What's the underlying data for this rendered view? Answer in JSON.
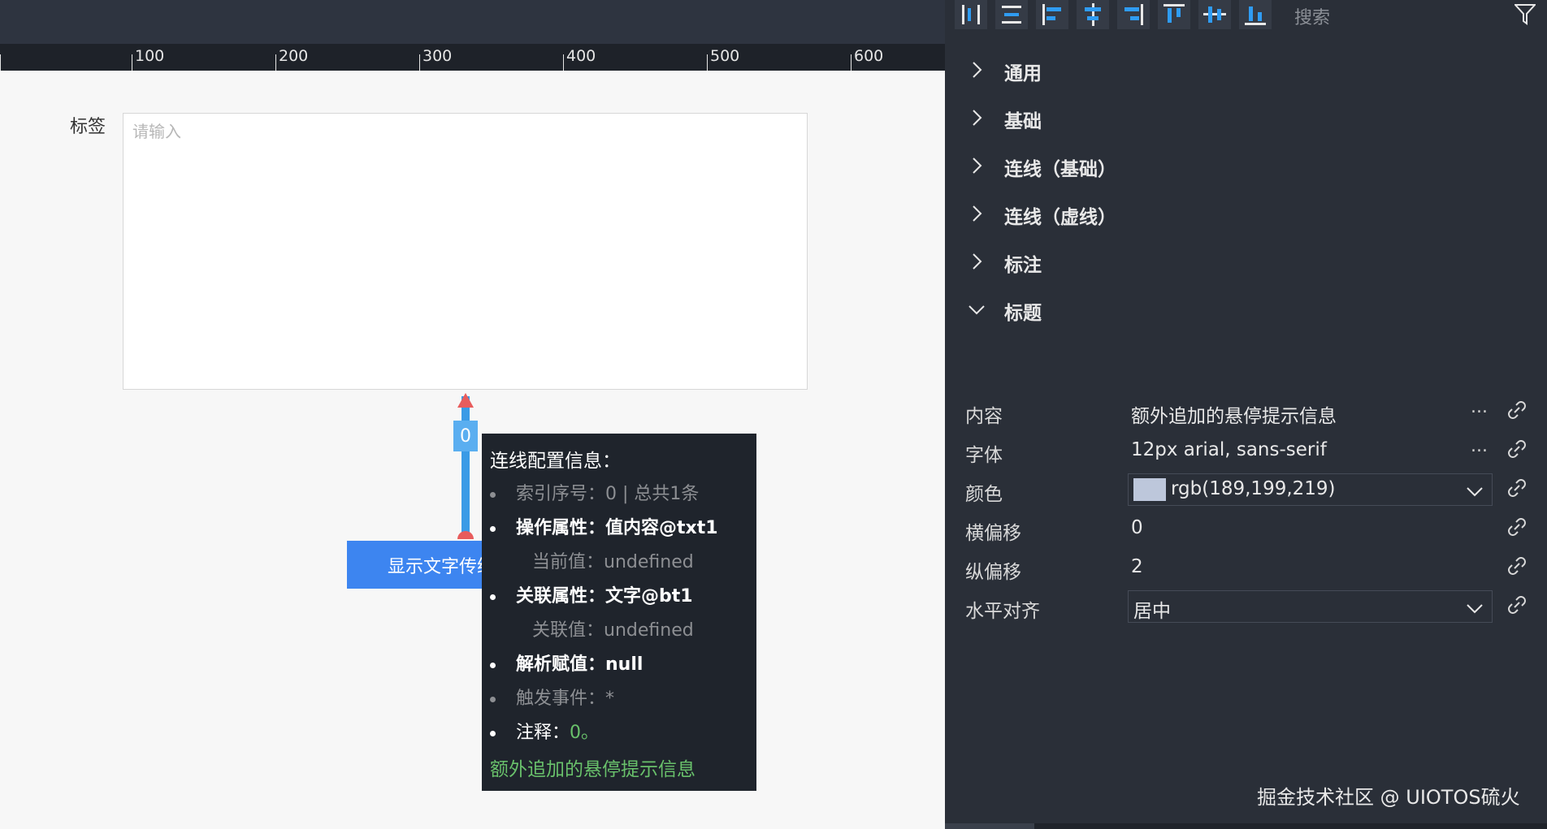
{
  "ruler": {
    "ticks": [
      "100",
      "200",
      "300",
      "400",
      "500",
      "600"
    ]
  },
  "canvas": {
    "field_label": "标签",
    "textarea_placeholder": "请输入",
    "index_label": "0",
    "button_label": "显示文字传给"
  },
  "tooltip": {
    "title": "连线配置信息：",
    "rows": [
      {
        "text": "索引序号：0 | 总共1条",
        "style": "gray"
      },
      {
        "text": "操作属性：值内容@txt1",
        "style": "white"
      },
      {
        "text": "当前值：undefined",
        "style": "gray",
        "indent": true
      },
      {
        "text": "关联属性：文字@bt1",
        "style": "white"
      },
      {
        "text": "关联值：undefined",
        "style": "gray",
        "indent": true
      },
      {
        "text": "解析赋值：null",
        "style": "white"
      },
      {
        "text": "触发事件：*",
        "style": "gray"
      },
      {
        "label": "注释：",
        "value": "0。",
        "style": "note"
      }
    ],
    "footer": "额外追加的悬停提示信息"
  },
  "panel": {
    "search_placeholder": "搜索",
    "sections": [
      {
        "label": "通用",
        "expanded": false
      },
      {
        "label": "基础",
        "expanded": false
      },
      {
        "label": "连线（基础）",
        "expanded": false
      },
      {
        "label": "连线（虚线）",
        "expanded": false
      },
      {
        "label": "标注",
        "expanded": false
      },
      {
        "label": "标题",
        "expanded": true
      }
    ],
    "properties": {
      "content": {
        "label": "内容",
        "value": "额外追加的悬停提示信息",
        "more": "..."
      },
      "font": {
        "label": "字体",
        "value": "12px arial, sans-serif",
        "more": "..."
      },
      "color": {
        "label": "颜色",
        "value": "rgb(189,199,219)",
        "swatch": "#bdc7db"
      },
      "offset_x": {
        "label": "横偏移",
        "value": "0"
      },
      "offset_y": {
        "label": "纵偏移",
        "value": "2"
      },
      "h_align": {
        "label": "水平对齐",
        "value": "居中"
      }
    }
  },
  "watermark": "掘金技术社区 @ UIOTOS硫火",
  "colors": {
    "accent_blue": "#3d85f0",
    "connector_blue": "#3a9be6",
    "arrow_red": "#e85c5c",
    "note_green": "#69c16b",
    "toolbar_icon_blue": "#2f9cf3",
    "panel_bg": "#2a2f38"
  }
}
